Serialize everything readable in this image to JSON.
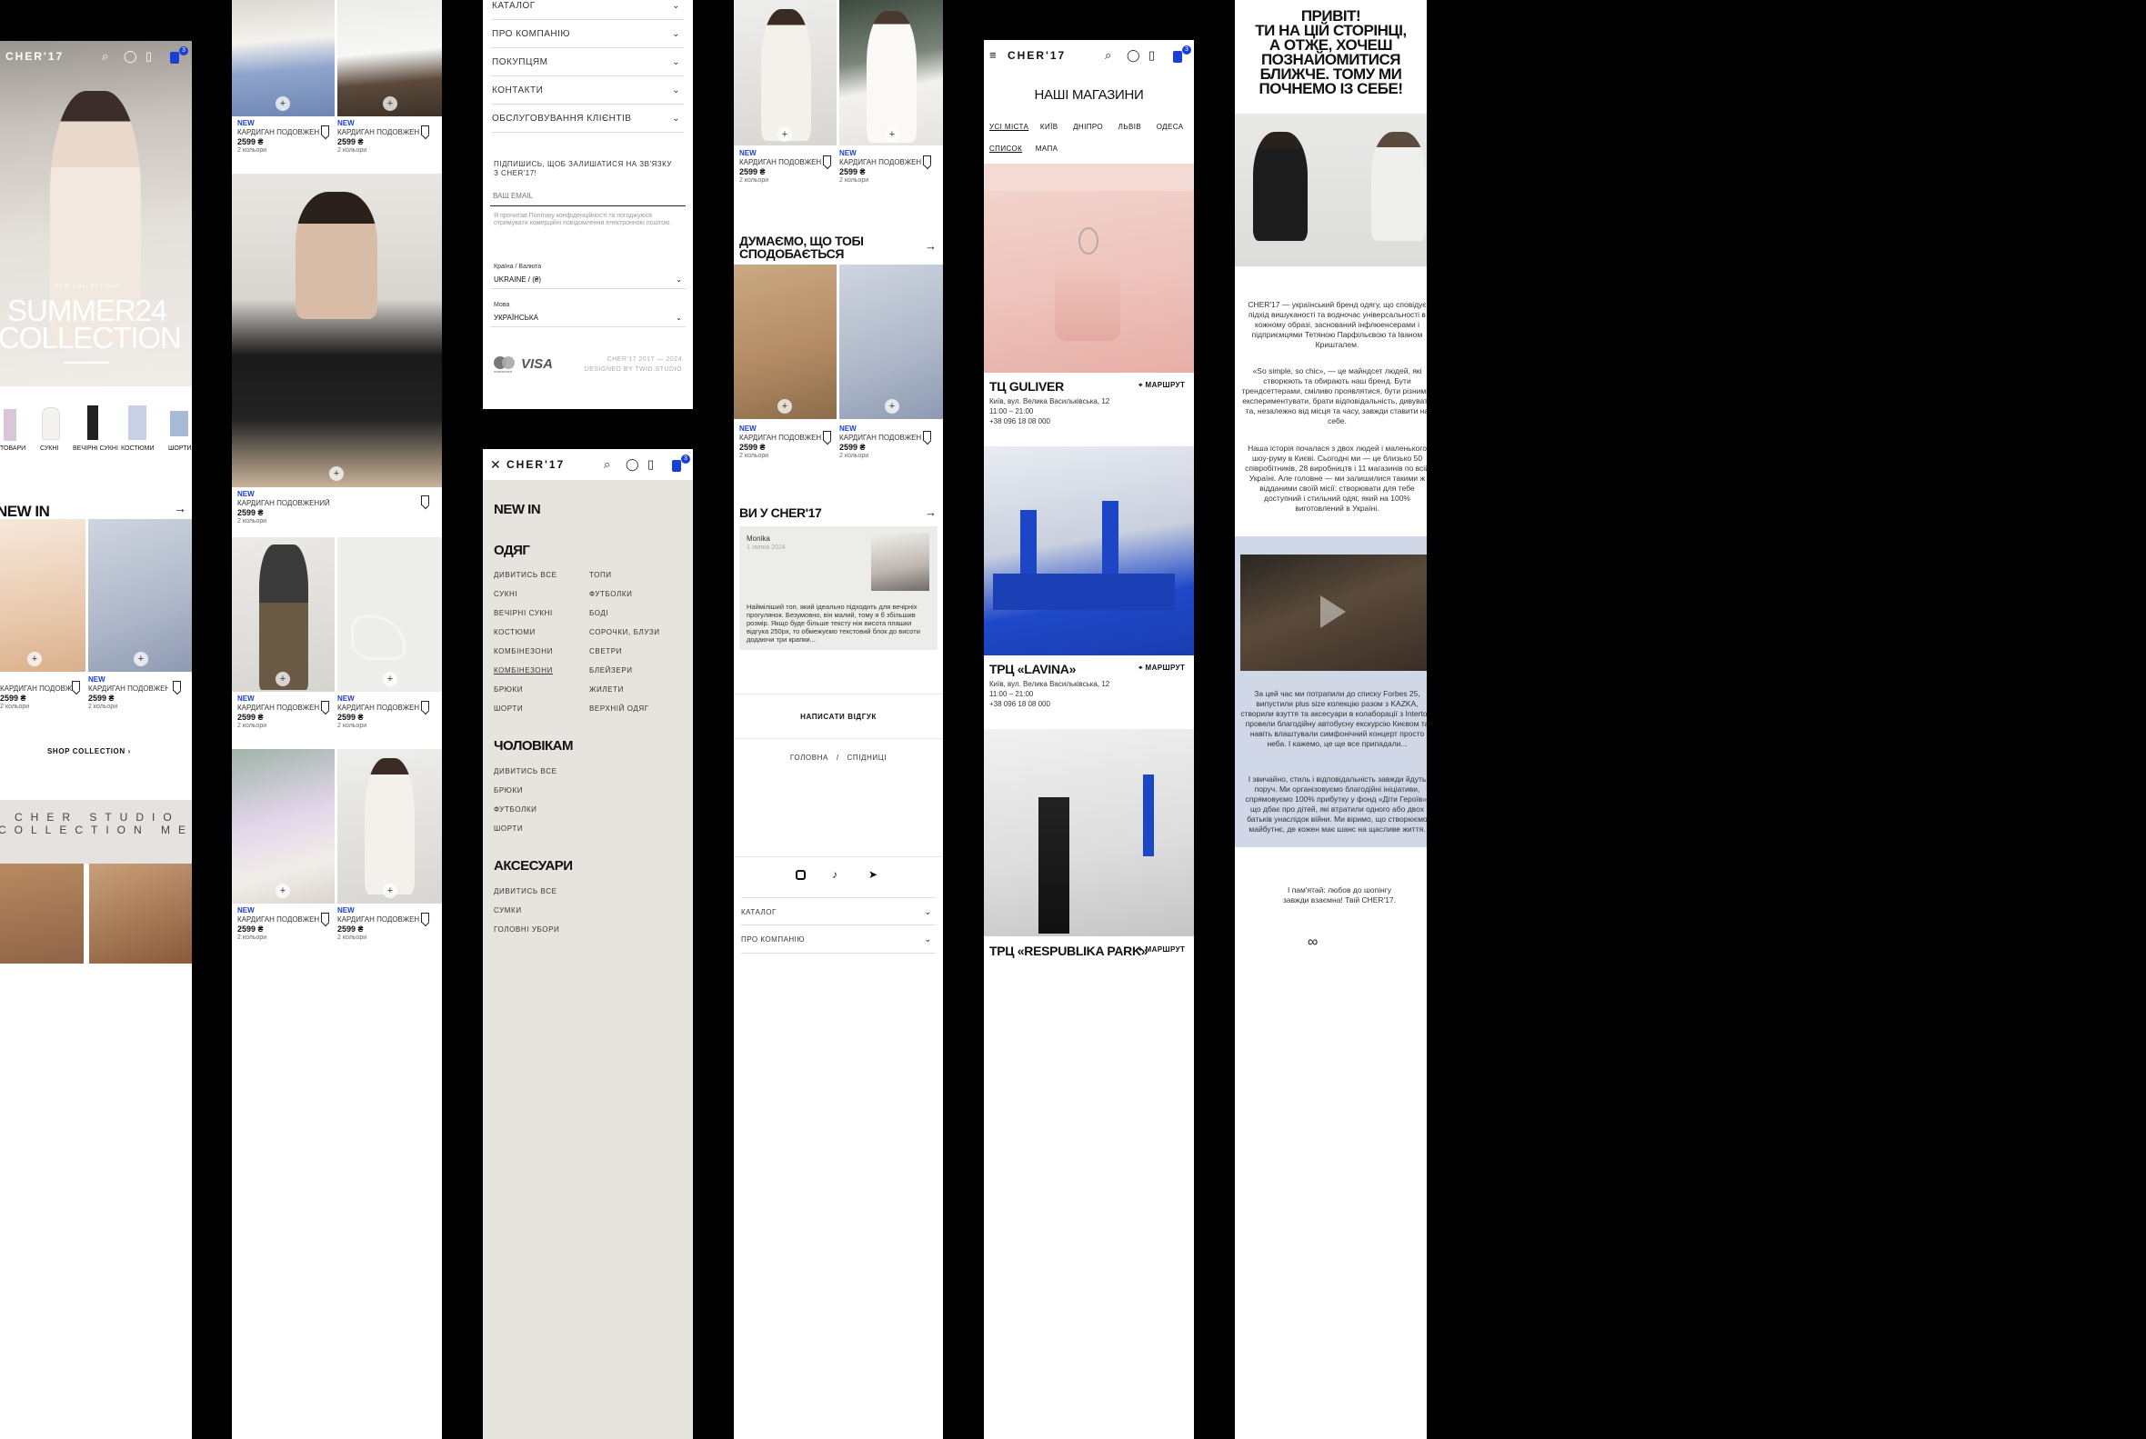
{
  "brand": {
    "logo": "CHER'17",
    "accent": "#1a3fd6",
    "cart_count": "3"
  },
  "product_card": {
    "badge": "NEW",
    "name": "КАРДИГАН ПОДОВЖЕНИ...",
    "name_full": "КАРДИГАН ПОДОВЖЕНИЙ",
    "price": "2599 ₴",
    "colors": "2 кольори"
  },
  "home": {
    "hero_kicker": "NEW COLLECTIONS",
    "hero_title_1": "SUMMER24",
    "hero_title_2": "COLLECTION",
    "categories": [
      "ТОВАРИ",
      "СУКНІ",
      "ВЕЧІРНІ СУКНІ",
      "КОСТЮМИ",
      "ШОРТИ"
    ],
    "new_in": "NEW IN",
    "shop_collection": "SHOP COLLECTION",
    "banner_line1": "CHER STUDIO",
    "banner_line2": "COLLECTION MEN"
  },
  "footer": {
    "accordion": [
      "КАТАЛОГ",
      "ПРО КОМПАНІЮ",
      "ПОКУПЦЯМ",
      "КОНТАКТИ",
      "ОБСЛУГОВУВАННЯ КЛІЄНТІВ"
    ],
    "subscribe": "ПІДПИШИСЬ, ЩОБ ЗАЛИШАТИСЯ НА ЗВ'ЯЗКУ З CHER'17!",
    "email_placeholder": "ВАШ EMAIL",
    "consent": "Я прочитав Політику конфіденційності та погоджуюся отримувати комерційні повідомлення електронною поштою.",
    "country_label": "Країна / Валюта",
    "country_value": "UKRAINE / (₴)",
    "lang_label": "Мова",
    "lang_value": "УКРАЇНСЬКА",
    "mastercard": "mastercard",
    "visa": "VISA",
    "copyright": "CHER'17 2017 — 2024",
    "designed": "DESIGNED BY TWID.STUDIO"
  },
  "menu": {
    "new_in": "NEW IN",
    "clothes": "ОДЯГ",
    "clothes_left": [
      "ДИВИТИСЬ ВСЕ",
      "СУКНІ",
      "ВЕЧІРНІ СУКНІ",
      "КОСТЮМИ",
      "КОМБІНЕЗОНИ",
      "КОМБІНЕЗОНИ",
      "БРЮКИ",
      "ШОРТИ"
    ],
    "clothes_right": [
      "ТОПИ",
      "ФУТБОЛКИ",
      "БОДІ",
      "СОРОЧКИ, БЛУЗИ",
      "СВЕТРИ",
      "БЛЕЙЗЕРИ",
      "ЖИЛЕТИ",
      "ВЕРХНІЙ ОДЯГ"
    ],
    "men": "ЧОЛОВІКАМ",
    "men_items": [
      "ДИВИТИСЬ ВСЕ",
      "БРЮКИ",
      "ФУТБОЛКИ",
      "ШОРТИ"
    ],
    "acc": "АКСЕСУАРИ",
    "acc_items": [
      "ДИВИТИСЬ ВСЕ",
      "СУМКИ",
      "ГОЛОВНІ УБОРИ"
    ]
  },
  "product_page": {
    "like_title_1": "ДУМАЄМО, ЩО ТОБІ",
    "like_title_2": "СПОДОБАЄТЬСЯ",
    "you_title": "ВИ У CHER'17",
    "review_name": "Monika",
    "review_date": "1 липня 2024",
    "review_text": "Найміліший топ, який ідеально підходить для вечірніх прогулянок. Безумовно, він малий, тому я б збільшив розмір. Якщо буде більше тексту ніж висота плашки відгука 250px, то обмежуємо текстовий блок до висоти додаючи три крапки...",
    "write_review": "НАПИСАТИ ВІДГУК",
    "crumb_home": "ГОЛОВНА",
    "crumb_sep": "/",
    "crumb_current": "СПІДНИЦІ",
    "acc": [
      "КАТАЛОГ",
      "ПРО КОМПАНІЮ"
    ]
  },
  "stores": {
    "title": "НАШІ МАГАЗИНИ",
    "cities": [
      "УСІ МІСТА",
      "КИЇВ",
      "ДНІПРО",
      "ЛЬВІВ",
      "ОДЕСА"
    ],
    "views": [
      "СПИСОК",
      "МАПА"
    ],
    "route": "МАРШРУТ",
    "list": [
      {
        "name": "ТЦ GULIVER",
        "address": "Київ, вул. Велика Васильківська, 12",
        "hours": "11:00 – 21:00",
        "phone": "+38 096 18 08 000"
      },
      {
        "name": "ТРЦ «LAVINA»",
        "address": "Київ, вул. Велика Васильківська, 12",
        "hours": "11:00 – 21:00",
        "phone": "+38 096 18 08 000"
      },
      {
        "name": "ТРЦ «RESPUBLIKA PARK»"
      }
    ]
  },
  "about": {
    "heading": [
      "ПРИВІТ!",
      "ТИ НА ЦІЙ СТОРІНЦІ,",
      "А ОТЖЕ, ХОЧЕШ",
      "ПОЗНАЙОМИТИСЯ",
      "БЛИЖЧЕ. ТОМУ МИ",
      "ПОЧНЕМО ІЗ СЕБЕ!"
    ],
    "p1": "CHER'17 — український бренд одягу, що сповідує підхід вишуканості та водночас універсальності в кожному образі, заснований інфлюенсерами і підприємцями Тетяною Парфільєвою та Іваном Кришталем.",
    "p2": "«So simple, so chic», — це майндсет людей, які створюють та обирають наш бренд. Бути трендсеттерами, сміливо проявлятися, бути різними, експериментувати, брати відповідальність, дивувати та, незалежно від місця та часу, завжди ставити на себе.",
    "p3": "Наша історія почалася з двох людей і маленького шоу-руму в Києві. Сьогодні ми — це близько 50 співробітників, 28 виробництв і 11 магазинів по всій Україні. Але головне — ми залишилися такими ж відданими своїй місії: створювати для тебе доступний і стильний одяг, який на 100% виготовлений в Україні.",
    "p4": "За цей час ми потрапили до списку Forbes 25, випустили plus size колекцію разом з KAZKA, створили взуття та аксесуари в колаборації з Intertop, провели благодійну автобусну екскурсію Києвом та навіть влаштували симфонічний концерт просто неба. І кажемо, це ще все припадали...",
    "p5": "І звичайно, стиль і відповідальність завжди йдуть поруч. Ми організовуємо благодійні ініціативи, спрямовуємо 100% прибутку у фонд «Діти Героїв», що дбає про дітей, які втратили одного або двох батьків унаслідок війни. Ми віримо, що створюємо майбутнє, де кожен має шанс на щасливе життя.",
    "p6": "І пам'ятай: любов до шопінгу завжди взаємна! Твій CHER'17."
  }
}
